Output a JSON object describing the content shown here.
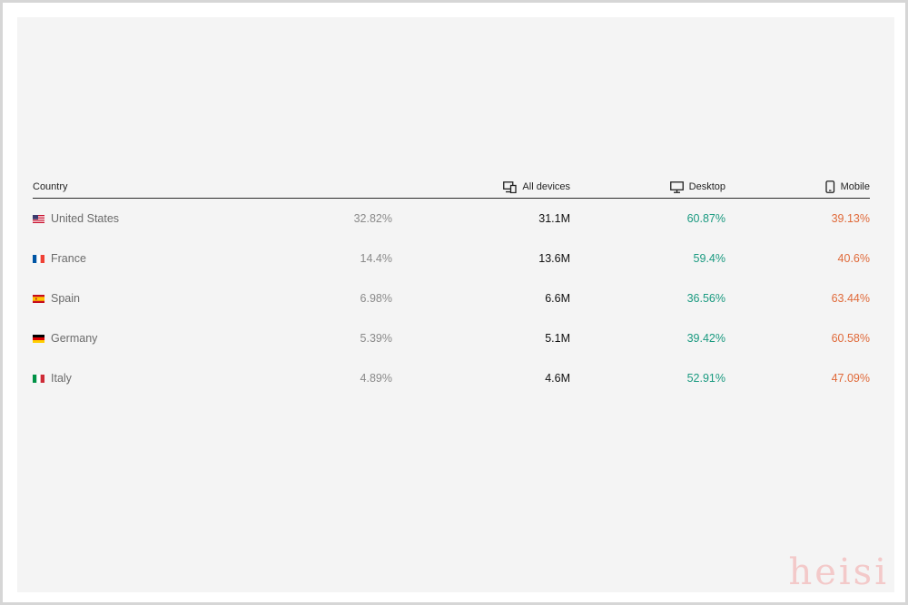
{
  "table": {
    "headers": {
      "country": "Country",
      "all_devices": "All devices",
      "desktop": "Desktop",
      "mobile": "Mobile"
    },
    "header_icons": {
      "all_devices": "devices-icon",
      "desktop": "desktop-icon",
      "mobile": "mobile-icon"
    },
    "rows": [
      {
        "country": "United States",
        "flag": "us-flag-icon",
        "share": "32.82%",
        "all_devices": "31.1M",
        "desktop": "60.87%",
        "mobile": "39.13%"
      },
      {
        "country": "France",
        "flag": "fr-flag-icon",
        "share": "14.4%",
        "all_devices": "13.6M",
        "desktop": "59.4%",
        "mobile": "40.6%"
      },
      {
        "country": "Spain",
        "flag": "es-flag-icon",
        "share": "6.98%",
        "all_devices": "6.6M",
        "desktop": "36.56%",
        "mobile": "63.44%"
      },
      {
        "country": "Germany",
        "flag": "de-flag-icon",
        "share": "5.39%",
        "all_devices": "5.1M",
        "desktop": "39.42%",
        "mobile": "60.58%"
      },
      {
        "country": "Italy",
        "flag": "it-flag-icon",
        "share": "4.89%",
        "all_devices": "4.6M",
        "desktop": "52.91%",
        "mobile": "47.09%"
      }
    ]
  },
  "colors": {
    "desktop_value": "#1a9a80",
    "mobile_value": "#e06a3a",
    "panel_background": "#f4f4f4"
  },
  "watermark": "heisi"
}
